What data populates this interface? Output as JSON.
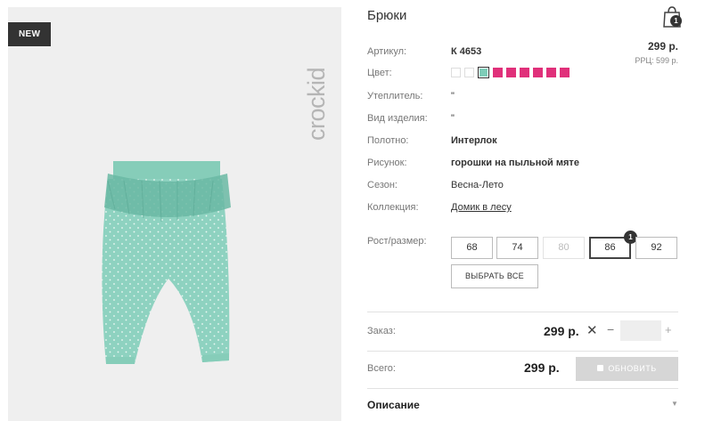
{
  "gallery": {
    "badge": "NEW",
    "brand": "crockid"
  },
  "product": {
    "title": "Брюки",
    "price": "299 р.",
    "rrp": "РРЦ: 599 р.",
    "image_alt": "pants-photo"
  },
  "cart": {
    "count": "1",
    "icon": "shopping-bag-icon"
  },
  "specs": {
    "article_label": "Артикул:",
    "article_value": "К 4653",
    "color_label": "Цвет:",
    "insulation_label": "Утеплитель:",
    "insulation_value": "\"",
    "type_label": "Вид изделия:",
    "type_value": "\"",
    "fabric_label": "Полотно:",
    "fabric_value": "Интерлок",
    "pattern_label": "Рисунок:",
    "pattern_value": "горошки на пыльной мяте",
    "season_label": "Сезон:",
    "season_value": "Весна-Лето",
    "collection_label": "Коллекция:",
    "collection_value": "Домик в лесу"
  },
  "colors": {
    "swatches": [
      {
        "color": "#ffffff",
        "state": "empty"
      },
      {
        "color": "#ffffff",
        "state": "empty"
      },
      {
        "color": "#7ecdb8",
        "state": "selected"
      },
      {
        "color": "#e0307a",
        "state": "normal"
      },
      {
        "color": "#e0307a",
        "state": "normal"
      },
      {
        "color": "#e0307a",
        "state": "normal"
      },
      {
        "color": "#e0307a",
        "state": "normal"
      },
      {
        "color": "#e0307a",
        "state": "normal"
      },
      {
        "color": "#e0307a",
        "state": "normal"
      }
    ]
  },
  "sizes": {
    "label": "Рост/размер:",
    "options": [
      {
        "label": "68",
        "state": "normal"
      },
      {
        "label": "74",
        "state": "normal"
      },
      {
        "label": "80",
        "state": "disabled"
      },
      {
        "label": "86",
        "state": "active",
        "qty": "1"
      },
      {
        "label": "92",
        "state": "normal"
      }
    ],
    "select_all": "ВЫБРАТЬ ВСЕ"
  },
  "order": {
    "label": "Заказ:",
    "price": "299 р.",
    "times": "✕",
    "minus": "−",
    "plus": "+",
    "qty_value": ""
  },
  "total": {
    "label": "Всего:",
    "price": "299 р.",
    "update_button": "ОБНОВИТЬ"
  },
  "description": {
    "label": "Описание",
    "arrow": "▼"
  }
}
